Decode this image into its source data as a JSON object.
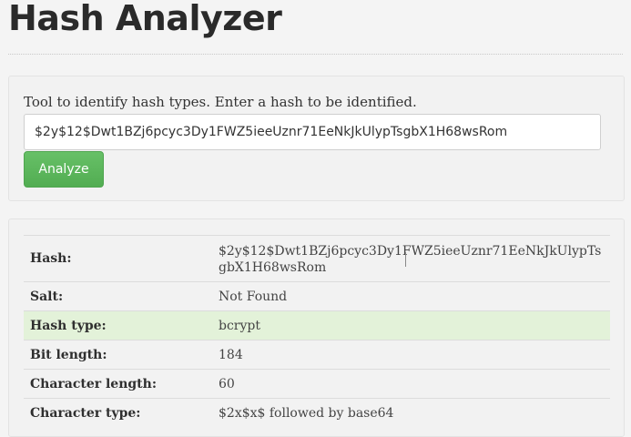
{
  "page": {
    "title": "Hash Analyzer"
  },
  "form": {
    "intro": "Tool to identify hash types. Enter a hash to be identified.",
    "hash_value": "$2y$12$Dwt1BZj6pcyc3Dy1FWZ5ieeUznr71EeNkJkUlypTsgbX1H68wsRom",
    "analyze_label": "Analyze",
    "accent_color": "#5cb85c"
  },
  "results": {
    "rows": [
      {
        "label": "Hash:",
        "value": "$2y$12$Dwt1BZj6pcyc3Dy1FWZ5ieeUznr71EeNkJkUlypTsgbX1H68wsRom"
      },
      {
        "label": "Salt:",
        "value": "Not Found"
      },
      {
        "label": "Hash type:",
        "value": "bcrypt"
      },
      {
        "label": "Bit length:",
        "value": "184"
      },
      {
        "label": "Character length:",
        "value": "60"
      },
      {
        "label": "Character type:",
        "value": "$2x$x$ followed by base64"
      }
    ],
    "highlight_color": "#e3f2d9"
  }
}
